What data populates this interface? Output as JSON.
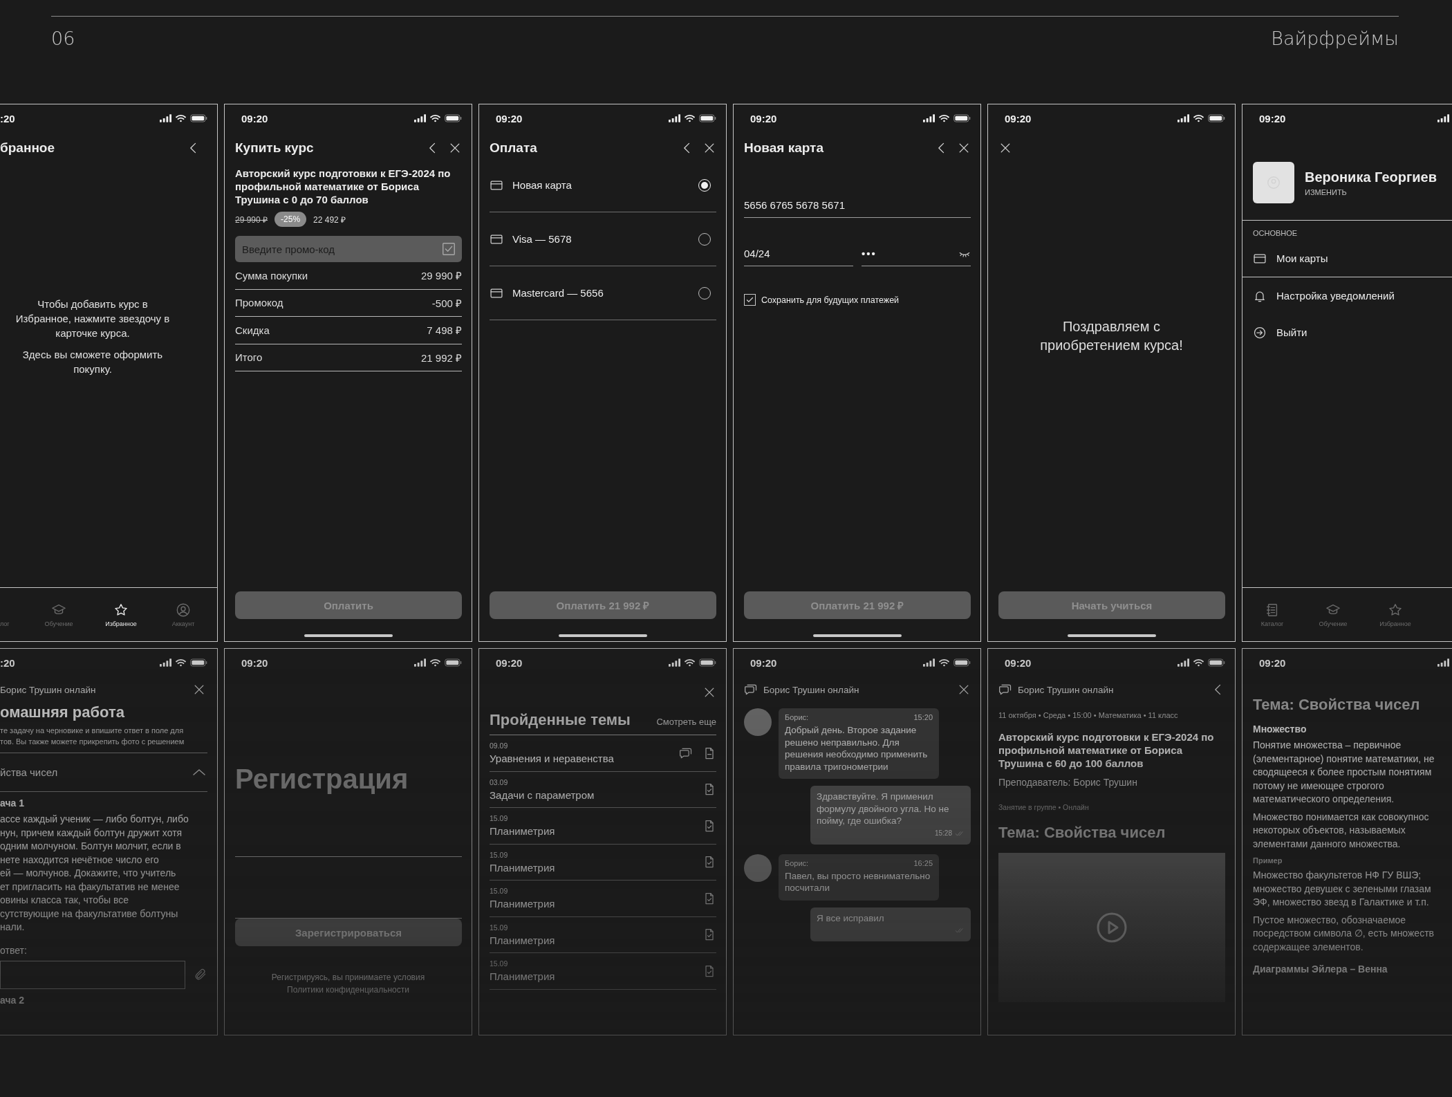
{
  "header": {
    "number": "06",
    "title": "Вайрфреймы"
  },
  "rows": [
    {
      "kind": "full",
      "screens": [
        {
          "time": ":20",
          "blocks": [
            {
              "kind": "header",
              "title": "бранное",
              "buttons": [
                {
                  "kind": "back"
                }
              ]
            },
            {
              "kind": "empty_message",
              "paragraphs": [
                "Чтобы добавить курс в Избранное, нажмите звездочу в карточке курса.",
                "Здесь вы сможете оформить покупку."
              ]
            },
            {
              "kind": "tabbar",
              "tabs": [
                {
                  "label": "лог",
                  "selected": false
                },
                {
                  "label": "Обучение",
                  "selected": false
                },
                {
                  "label": "Избранное",
                  "selected": true
                },
                {
                  "label": "Аккаунт",
                  "selected": false
                }
              ]
            }
          ]
        },
        {
          "time": "09:20",
          "blocks": [
            {
              "kind": "header",
              "title": "Купить курс",
              "buttons": [
                {
                  "kind": "back"
                },
                {
                  "kind": "close"
                }
              ]
            },
            {
              "kind": "course_title",
              "text": "Авторский курс подготовки к ЕГЭ-2024 по профильной математике от Бориса Трушина с 0 до 70 баллов"
            },
            {
              "kind": "price",
              "old": "29 990 ₽",
              "discount": "-25%",
              "new": "22 492 ₽"
            },
            {
              "kind": "promo_field",
              "placeholder": "Введите промо-код"
            },
            {
              "kind": "summary_row",
              "label": "Сумма покупки",
              "value": "29 990 ₽"
            },
            {
              "kind": "summary_row",
              "label": "Промокод",
              "value": "-500 ₽"
            },
            {
              "kind": "summary_row",
              "label": "Скидка",
              "value": "7 498 ₽"
            },
            {
              "kind": "summary_row",
              "label": "Итого",
              "value": "21 992 ₽"
            },
            {
              "kind": "button",
              "label": "Оплатить",
              "disabled": true
            }
          ]
        },
        {
          "time": "09:20",
          "blocks": [
            {
              "kind": "header",
              "title": "Оплата",
              "buttons": [
                {
                  "kind": "back"
                },
                {
                  "kind": "close"
                }
              ]
            },
            {
              "kind": "card_option",
              "label": "Новая карта",
              "selected": true
            },
            {
              "kind": "card_option",
              "label": "Visa — 5678",
              "selected": false
            },
            {
              "kind": "card_option",
              "label": "Mastercard — 5656",
              "selected": false
            },
            {
              "kind": "button",
              "label": "Оплатить 21 992 ₽",
              "disabled": true
            }
          ]
        },
        {
          "time": "09:20",
          "blocks": [
            {
              "kind": "header",
              "title": "Новая карта",
              "buttons": [
                {
                  "kind": "back"
                },
                {
                  "kind": "close"
                }
              ]
            },
            {
              "kind": "input_line",
              "value": "5656 6765 5678 5671"
            },
            {
              "kind": "expiry_cvv",
              "expiry": "04/24",
              "cvv": "•••"
            },
            {
              "kind": "checkbox",
              "label": "Сохранить для будущих платежей",
              "checked": true
            },
            {
              "kind": "button",
              "label": "Оплатить 21 992 ₽",
              "disabled": true
            }
          ]
        },
        {
          "time": "09:20",
          "blocks": [
            {
              "kind": "modal_header",
              "buttons": [
                {
                  "kind": "close"
                }
              ]
            },
            {
              "kind": "center_message",
              "text": "Поздравляем с приобретением курса!"
            },
            {
              "kind": "button",
              "label": "Начать учиться",
              "disabled": true
            }
          ]
        },
        {
          "time": "09:20",
          "blocks": [
            {
              "kind": "profile",
              "name": "Вероника Георгиев",
              "action": "ИЗМЕНИТЬ"
            },
            {
              "kind": "section_label",
              "text": "ОСНОВНОЕ"
            },
            {
              "kind": "menu_item",
              "label": "Мои карты"
            },
            {
              "kind": "menu_item",
              "label": "Настройка уведомлений"
            },
            {
              "kind": "menu_item",
              "label": "Выйти"
            },
            {
              "kind": "tabbar",
              "tabs": [
                {
                  "label": "Каталог",
                  "selected": false
                },
                {
                  "label": "Обучение",
                  "selected": false
                },
                {
                  "label": "Избранное",
                  "selected": false
                }
              ]
            }
          ]
        }
      ]
    },
    {
      "kind": "faded",
      "screens": [
        {
          "time": ":20",
          "blocks": [
            {
              "kind": "chat_header",
              "text": "Борис Трушин онлайн",
              "buttons": [
                {
                  "kind": "close"
                }
              ]
            },
            {
              "kind": "page_title",
              "text": "омашняя работа"
            },
            {
              "kind": "note",
              "lines": [
                "те задачу на черновике и впишите ответ в поле для",
                "тов. Вы также можете прикрепить фото с решением"
              ]
            },
            {
              "kind": "accordion",
              "label": "йства чисел",
              "expanded": true
            },
            {
              "kind": "task_title",
              "text": "ача 1"
            },
            {
              "kind": "paragraph",
              "lines": [
                "ассе каждый ученик — либо болтун, либо",
                "нун, причем каждый болтун дружит хотя",
                "одним молчуном. Болтун молчит, если в",
                "нете находится нечётное число его",
                "ей — молчунов. Докажите, что учитель",
                "ет пригласить на факультатив не менее",
                "овины класса так, чтобы все",
                "сутствующие на факультативе болтуны",
                "нали."
              ]
            },
            {
              "kind": "answer",
              "label": "ответ:"
            },
            {
              "kind": "task_title",
              "text": "ача 2"
            }
          ]
        },
        {
          "time": "09:20",
          "blocks": [
            {
              "kind": "big_title",
              "text": "Регистрация"
            },
            {
              "kind": "input_line"
            },
            {
              "kind": "input_line"
            },
            {
              "kind": "button",
              "label": "Зарегистрироваться",
              "disabled": true
            },
            {
              "kind": "footnote",
              "lines": [
                "Регистрируясь, вы принимаете условия",
                "Политики конфиденциальности"
              ]
            }
          ]
        },
        {
          "time": "09:20",
          "blocks": [
            {
              "kind": "header",
              "buttons": [
                {
                  "kind": "close"
                }
              ]
            },
            {
              "kind": "section_head",
              "title": "Пройденные темы",
              "link": "Смотреть еще"
            },
            {
              "kind": "topic",
              "date": "09.09",
              "title": "Уравнения и неравенства",
              "chat": true,
              "done": false
            },
            {
              "kind": "topic",
              "date": "03.09",
              "title": "Задачи с параметром",
              "chat": false,
              "done": true
            },
            {
              "kind": "topic",
              "date": "15.09",
              "title": "Планиметрия",
              "chat": false,
              "done": true
            },
            {
              "kind": "topic",
              "date": "15.09",
              "title": "Планиметрия",
              "chat": false,
              "done": true
            },
            {
              "kind": "topic",
              "date": "15.09",
              "title": "Планиметрия",
              "chat": false,
              "done": true
            },
            {
              "kind": "topic",
              "date": "15.09",
              "title": "Планиметрия",
              "chat": false,
              "done": true
            },
            {
              "kind": "topic",
              "date": "15.09",
              "title": "Планиметрия",
              "chat": false,
              "done": true
            }
          ]
        },
        {
          "time": "09:20",
          "blocks": [
            {
              "kind": "chat_header",
              "text": "Борис Трушин онлайн",
              "buttons": [
                {
                  "kind": "close"
                }
              ]
            },
            {
              "kind": "message_in",
              "author": "Борис:",
              "time": "15:20",
              "text": "Добрый день. Второе задание решено неправильно. Для решения необходимо применить правила тригонометрии"
            },
            {
              "kind": "message_out",
              "text": "Здравствуйте. Я применил формулу двойного угла. Но не пойму, где ошибка?",
              "time": "15:28"
            },
            {
              "kind": "message_in",
              "author": "Борис:",
              "time": "16:25",
              "text": "Павел, вы просто невнимательно посчитали"
            },
            {
              "kind": "message_out",
              "text": "Я все исправил"
            }
          ]
        },
        {
          "time": "09:20",
          "blocks": [
            {
              "kind": "chat_header",
              "text": "Борис Трушин онлайн",
              "buttons": [
                {
                  "kind": "back"
                }
              ]
            },
            {
              "kind": "meta",
              "text": "11 октября • Среда • 15:00 • Математика • 11 класс"
            },
            {
              "kind": "course_title",
              "text": "Авторский курс подготовки к ЕГЭ-2024 по профильной математике от Бориса Трушина с 60 до 100 баллов"
            },
            {
              "kind": "subtitle",
              "text": "Преподаватель: Борис Трушин"
            },
            {
              "kind": "meta_small",
              "text": "Занятие в группе • Онлайн"
            },
            {
              "kind": "topic_title",
              "text": "Тема: Свойства чисел"
            },
            {
              "kind": "video"
            }
          ]
        },
        {
          "time": "09:20",
          "blocks": [
            {
              "kind": "topic_title",
              "text": "Тема: Свойства чисел"
            },
            {
              "kind": "subheading",
              "text": "Множество"
            },
            {
              "kind": "paragraph",
              "lines": [
                "Понятие множества – первичное",
                "(элементарное) понятие математики, не",
                "сводящееся к более простым понятиям",
                "потому не имеющее строгого",
                "математического определения."
              ]
            },
            {
              "kind": "paragraph",
              "lines": [
                "Множество понимается как совокупнос",
                "некоторых объектов, называемых",
                "элементами данного множества."
              ]
            },
            {
              "kind": "caption",
              "text": "Пример"
            },
            {
              "kind": "paragraph",
              "lines": [
                "Множество факультетов НФ ГУ ВШЭ;",
                "множество девушек с зелеными глазам",
                "ЭФ, множество звезд в Галактике и т.п."
              ]
            },
            {
              "kind": "paragraph",
              "lines": [
                "Пустое множество, обозначаемое",
                "посредством символа ∅, есть множеств",
                "содержащее элементов."
              ]
            },
            {
              "kind": "subheading",
              "text": "Диаграммы Эйлера – Венна"
            }
          ]
        }
      ]
    }
  ]
}
